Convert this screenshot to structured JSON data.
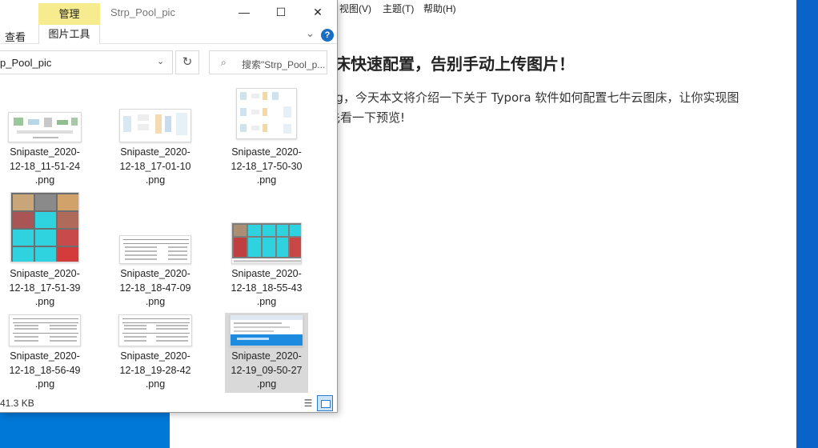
{
  "typora": {
    "menu": [
      "视图(V)",
      "主题(T)",
      "帮助(H)"
    ],
    "heading": "床快速配置，告别手动上传图片！",
    "para1": "ng，今天本文将介绍一下关于 Typora 软件如何配置七牛云图床，让你实现图",
    "para2": "先看一下预览!"
  },
  "explorer": {
    "manage_tab": "管理",
    "title": "Strp_Pool_pic",
    "btn_min": "—",
    "btn_max": "☐",
    "btn_close": "✕",
    "tab_view": "查看",
    "tab_picture_tools": "图片工具",
    "chevron": "⌄",
    "help": "?",
    "address": "p_Pool_pic",
    "address_dropdown": "⌄",
    "refresh": "↻",
    "search_icon": "⌕",
    "search_placeholder": "搜索\"Strp_Pool_p...",
    "status_size": "41.3 KB",
    "details_view": "☰",
    "files": [
      {
        "label": "Snipaste_2020-\n12-18_11-51-24\n.png"
      },
      {
        "label": "Snipaste_2020-\n12-18_17-01-10\n.png"
      },
      {
        "label": "Snipaste_2020-\n12-18_17-50-30\n.png"
      },
      {
        "label": "Snipaste_2020-\n12-18_17-51-39\n.png"
      },
      {
        "label": "Snipaste_2020-\n12-18_18-47-09\n.png"
      },
      {
        "label": "Snipaste_2020-\n12-18_18-55-43\n.png"
      },
      {
        "label": "Snipaste_2020-\n12-18_18-56-49\n.png"
      },
      {
        "label": "Snipaste_2020-\n12-18_19-28-42\n.png"
      },
      {
        "label": "Snipaste_2020-\n12-19_09-50-27\n.png"
      }
    ]
  }
}
